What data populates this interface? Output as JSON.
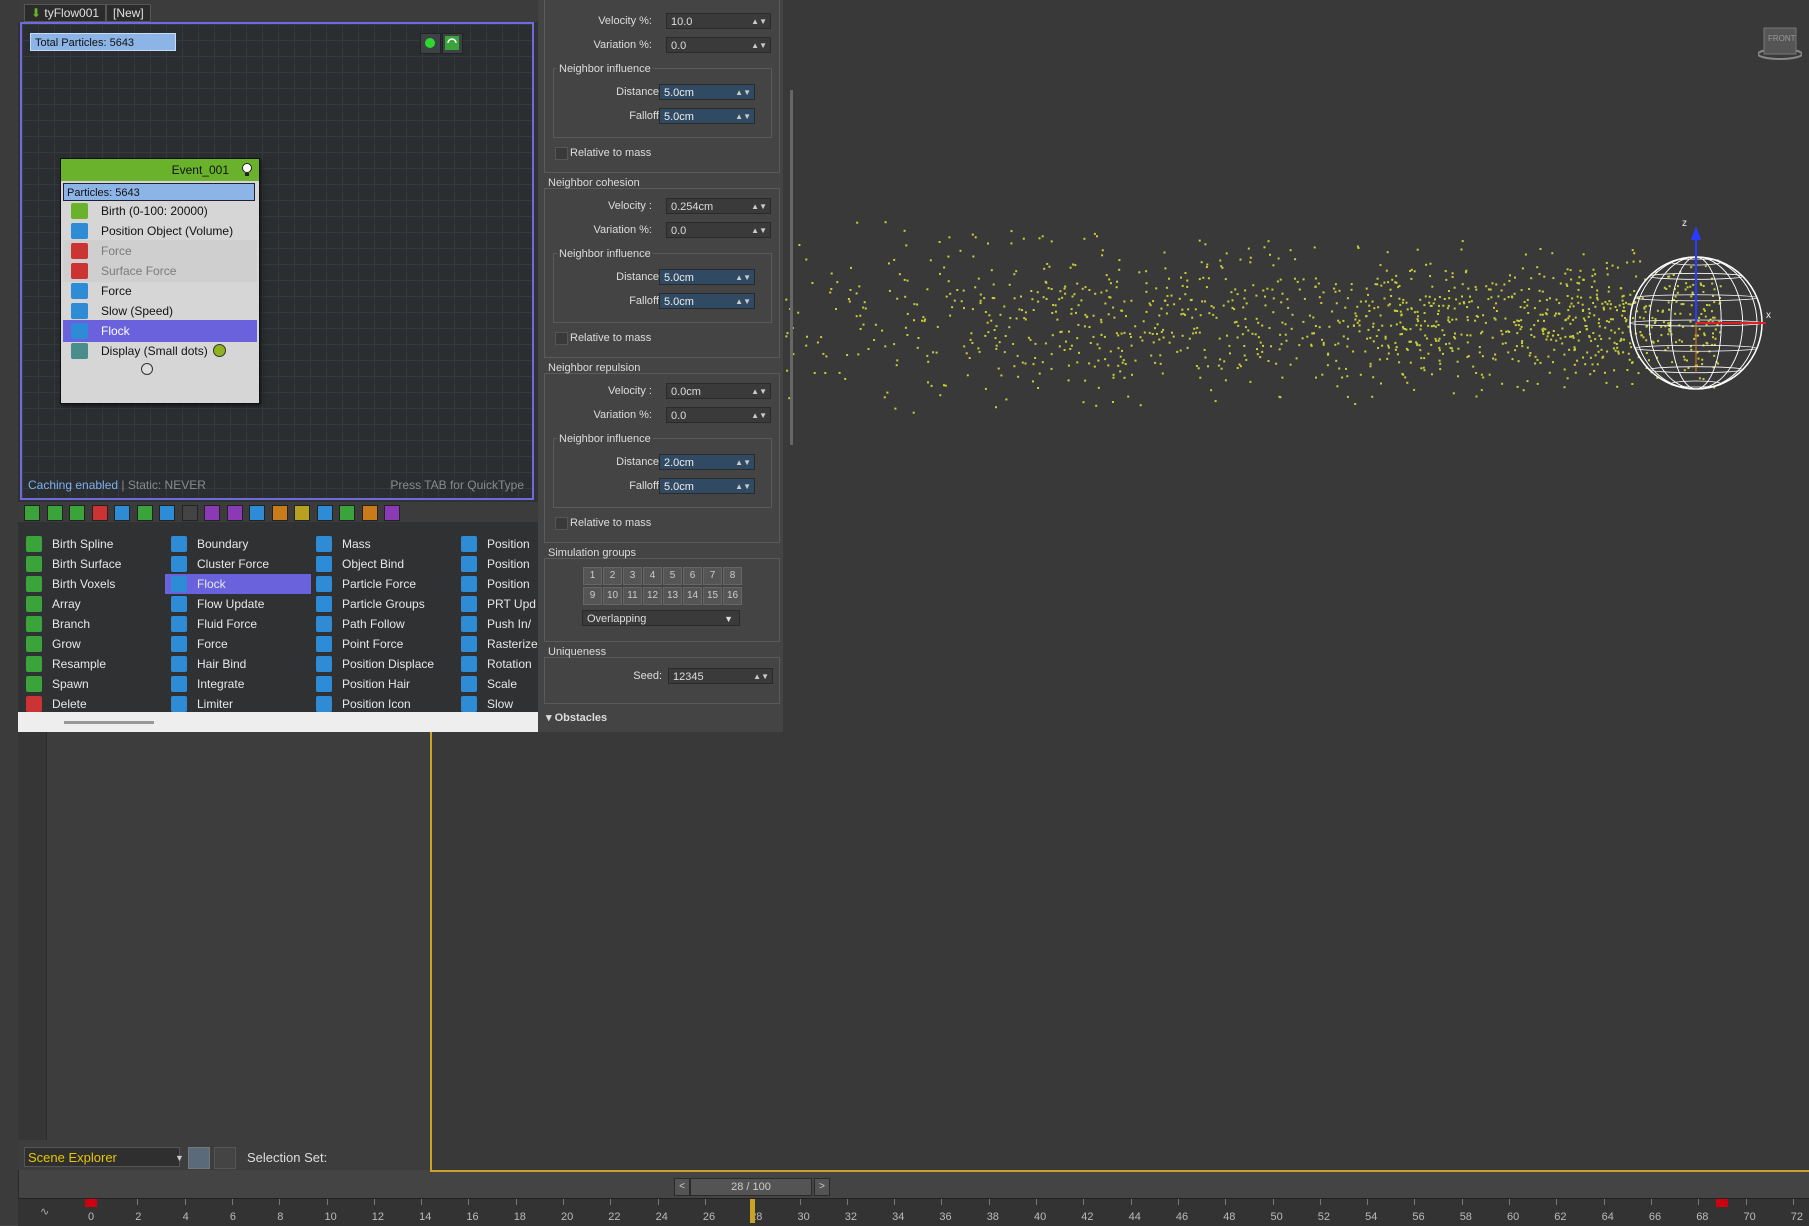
{
  "tyflow": {
    "tab_name": "tyFlow001",
    "tab_new": "[New]",
    "total_particles": "Total Particles: 5643",
    "event": {
      "name": "Event_001",
      "particles": "Particles: 5643",
      "operators": [
        {
          "label": "Birth (0-100: 20000)",
          "color": "#6ab22c",
          "state": "normal"
        },
        {
          "label": "Position Object (Volume)",
          "color": "#2e8bd6",
          "state": "normal"
        },
        {
          "label": "Force",
          "color": "#c33",
          "state": "disabled"
        },
        {
          "label": "Surface Force",
          "color": "#c33",
          "state": "disabled"
        },
        {
          "label": "Force",
          "color": "#2e8bd6",
          "state": "normal"
        },
        {
          "label": "Slow (Speed)",
          "color": "#2e8bd6",
          "state": "normal"
        },
        {
          "label": "Flock",
          "color": "#2e8bd6",
          "state": "selected"
        },
        {
          "label": "Display (Small dots)",
          "color": "#4a8d8d",
          "state": "normal"
        }
      ]
    },
    "status_caching": "Caching enabled",
    "status_static": "| Static: NEVER",
    "quicktype_hint": "Press TAB for QuickType",
    "palette": {
      "col1": [
        "Birth Spline",
        "Birth Surface",
        "Birth Voxels",
        "Array",
        "Branch",
        "Grow",
        "Resample",
        "Spawn",
        "Delete"
      ],
      "col2": [
        "Boundary",
        "Cluster Force",
        "Flock",
        "Flow Update",
        "Fluid Force",
        "Force",
        "Hair Bind",
        "Integrate",
        "Limiter"
      ],
      "col3": [
        "Mass",
        "Object Bind",
        "Particle Force",
        "Particle Groups",
        "Path Follow",
        "Point Force",
        "Position Displace",
        "Position Hair",
        "Position Icon"
      ],
      "col4": [
        "Position",
        "Position",
        "Position",
        "PRT Upd",
        "Push In/",
        "Rasterize",
        "Rotation",
        "Scale",
        "Slow"
      ],
      "selected": "Flock"
    }
  },
  "params": {
    "top": {
      "velocity_label": "Velocity %:",
      "velocity": "10.0",
      "variation_label": "Variation %:",
      "variation": "0.0",
      "ni_title": "Neighbor influence",
      "distance_label": "Distance:",
      "distance": "5.0cm",
      "falloff_label": "Falloff:",
      "falloff": "5.0cm",
      "relative_label": "Relative to mass"
    },
    "cohesion": {
      "title": "Neighbor cohesion",
      "velocity_label": "Velocity :",
      "velocity": "0.254cm",
      "variation_label": "Variation %:",
      "variation": "0.0",
      "ni_title": "Neighbor influence",
      "distance_label": "Distance:",
      "distance": "5.0cm",
      "falloff_label": "Falloff:",
      "falloff": "5.0cm",
      "relative_label": "Relative to mass"
    },
    "repulsion": {
      "title": "Neighbor repulsion",
      "velocity_label": "Velocity :",
      "velocity": "0.0cm",
      "variation_label": "Variation %:",
      "variation": "0.0",
      "ni_title": "Neighbor influence",
      "distance_label": "Distance:",
      "distance": "2.0cm",
      "falloff_label": "Falloff:",
      "falloff": "5.0cm",
      "relative_label": "Relative to mass"
    },
    "sim_groups": {
      "title": "Simulation groups",
      "buttons": [
        "1",
        "2",
        "3",
        "4",
        "5",
        "6",
        "7",
        "8",
        "9",
        "10",
        "11",
        "12",
        "13",
        "14",
        "15",
        "16"
      ],
      "mode": "Overlapping"
    },
    "uniqueness": {
      "title": "Uniqueness",
      "seed_label": "Seed:",
      "seed": "12345"
    },
    "obstacles_title": "Obstacles"
  },
  "scene": {
    "explorer_label": "Scene Explorer",
    "selection_set": "Selection Set:"
  },
  "timeline": {
    "frame_display": "28 / 100",
    "current_frame": 28,
    "ticks": [
      "0",
      "2",
      "4",
      "6",
      "8",
      "10",
      "12",
      "14",
      "16",
      "18",
      "20",
      "22",
      "24",
      "26",
      "28",
      "30",
      "32",
      "34",
      "36",
      "38",
      "40",
      "42",
      "44",
      "46",
      "48",
      "50",
      "52",
      "54",
      "56",
      "58",
      "60",
      "62",
      "64",
      "66",
      "68",
      "70",
      "72"
    ]
  },
  "viewport": {
    "view_label": "FRONT",
    "particle_color": "#c8cf3a",
    "axis_x": "x",
    "axis_z": "z"
  }
}
